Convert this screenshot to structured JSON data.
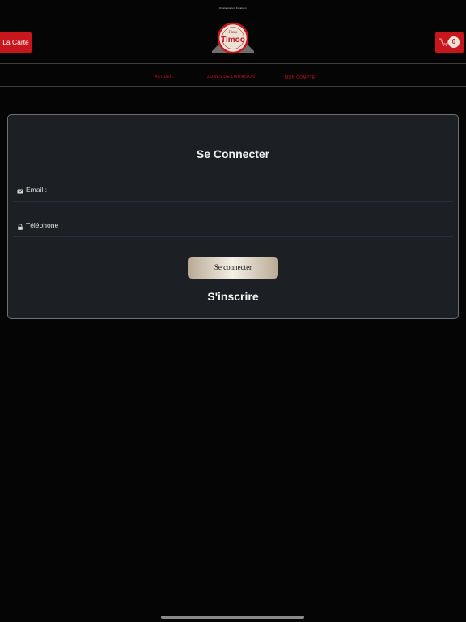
{
  "header": {
    "tagline": "Restauration livraison",
    "menu_button": "La Carte",
    "cart_count": "0",
    "logo_text": "Timoo",
    "logo_script": "Pizza"
  },
  "nav": {
    "items": [
      "ACCUEIL",
      "ZONES DE LIVRAISON",
      "MON COMPTE"
    ]
  },
  "login": {
    "title": "Se Connecter",
    "email_label": "Email :",
    "phone_label": "Téléphone :",
    "submit_label": "Se connecter",
    "register_label": "S'inscrire"
  },
  "colors": {
    "accent": "#c8161d",
    "background": "#050505",
    "card": "#1c1f23"
  },
  "icons": {
    "cart": "cart-icon",
    "email": "envelope-icon",
    "phone": "lock-icon"
  }
}
